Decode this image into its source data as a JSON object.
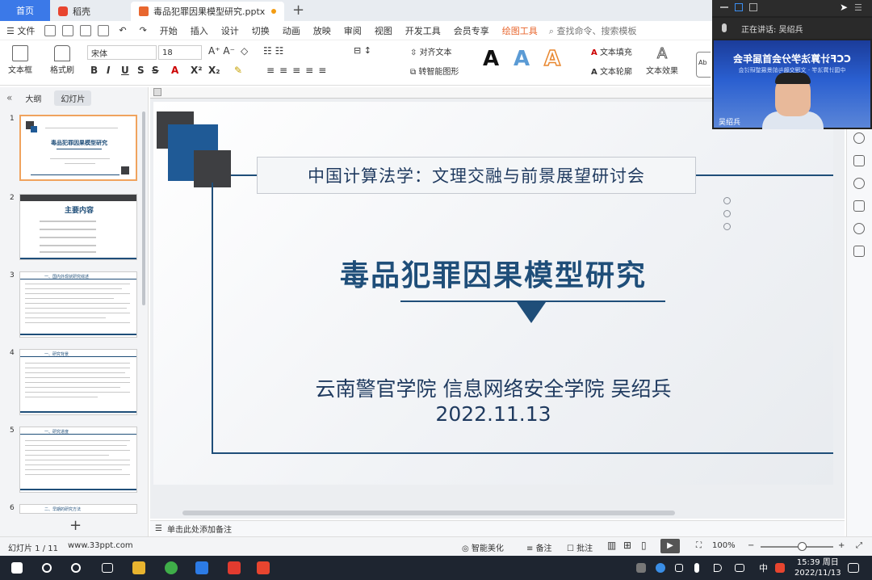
{
  "tabs": {
    "home": "首页",
    "docer": "稻壳",
    "doc": "毒品犯罪因果模型研究.pptx"
  },
  "menu": {
    "file": "文件",
    "items": [
      "开始",
      "插入",
      "设计",
      "切换",
      "动画",
      "放映",
      "审阅",
      "视图",
      "开发工具",
      "会员专享"
    ],
    "draw_tool": "绘图工具",
    "search_placeholder": "查找命令、搜索模板"
  },
  "ribbon": {
    "textbox": "文本框",
    "format_brush": "格式刷",
    "font_name": "宋体",
    "font_size": "18",
    "align_text": "对齐文本",
    "smart_graphic": "转智能图形",
    "text_fill": "文本填充",
    "text_outline": "文本轮廓",
    "text_effect": "文本效果",
    "letter_a": "A"
  },
  "leftpane": {
    "tab_outline": "大纲",
    "tab_slides": "幻灯片",
    "thumbs": [
      {
        "num": "1",
        "title": "毒品犯罪因果模型研究"
      },
      {
        "num": "2",
        "title": "主要内容"
      },
      {
        "num": "3",
        "title": "一、国内外现状研究综述"
      },
      {
        "num": "4",
        "title": "一、研究背景"
      },
      {
        "num": "5",
        "title": "一、研究进度"
      },
      {
        "num": "6",
        "title": "二、早期的研究方法"
      }
    ]
  },
  "slide": {
    "conf_title": "中国计算法学：文理交融与前景展望研讨会",
    "main_title": "毒品犯罪因果模型研究",
    "author": "云南警官学院 信息网络安全学院 吴绍兵",
    "date": "2022.11.13"
  },
  "notes_placeholder": "单击此处添加备注",
  "status": {
    "slide_count": "幻灯片 1 / 11",
    "website": "www.33ppt.com",
    "smart_beautify": "智能美化",
    "notes": "备注",
    "comments": "批注",
    "zoom": "100%"
  },
  "taskbar": {
    "time": "15:39 周日",
    "date": "2022/11/13",
    "ime": "中"
  },
  "video": {
    "speaking": "正在讲话: 吴绍兵",
    "banner": "CCF计算法学分会首届年会",
    "banner_sub": "中国计算法学 · 文理交融与前景展望研讨会",
    "name": "吴绍兵"
  },
  "colors": {
    "accent_blue": "#1f4e79",
    "slide_dark": "#3e3f42",
    "slide_blue": "#1f5a96",
    "wps_orange": "#e8672f"
  }
}
